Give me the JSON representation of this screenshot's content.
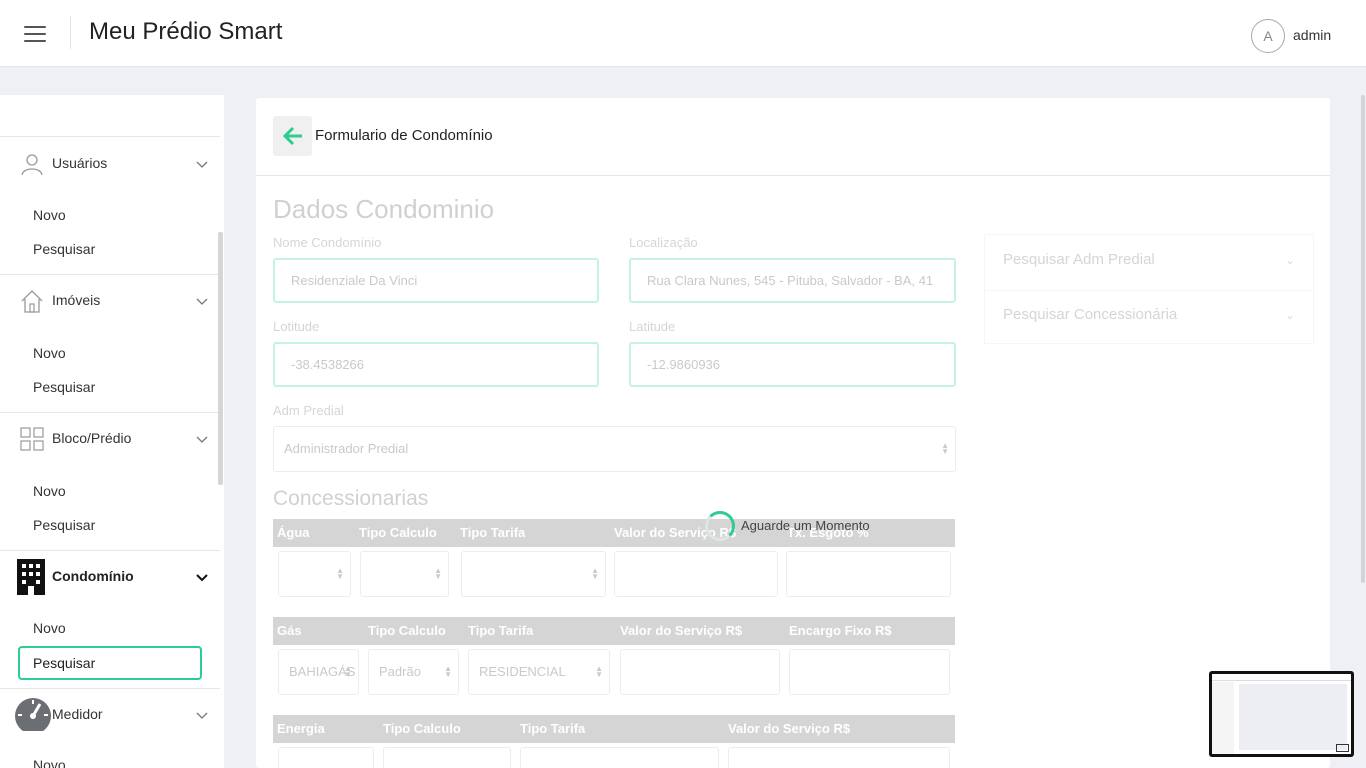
{
  "header": {
    "app_title": "Meu Prédio Smart",
    "avatar_letter": "A",
    "username": "admin"
  },
  "sidebar": {
    "sections": [
      {
        "label": "Usuários",
        "icon": "user-icon",
        "items": [
          "Novo",
          "Pesquisar"
        ]
      },
      {
        "label": "Imóveis",
        "icon": "house-icon",
        "items": [
          "Novo",
          "Pesquisar"
        ]
      },
      {
        "label": "Bloco/Prédio",
        "icon": "grid-icon",
        "items": [
          "Novo",
          "Pesquisar"
        ]
      },
      {
        "label": "Condomínio",
        "icon": "building-icon",
        "items": [
          "Novo",
          "Pesquisar"
        ],
        "active": true,
        "active_item": "Pesquisar"
      },
      {
        "label": "Medidor",
        "icon": "gauge-icon",
        "items": [
          "Novo"
        ]
      }
    ]
  },
  "card": {
    "title": "Formulario de Condomínio"
  },
  "form": {
    "section_title": "Dados Condominio",
    "nome_label": "Nome Condomínio",
    "nome_value": "Residenziale Da Vinci",
    "localizacao_label": "Localização",
    "localizacao_value": "Rua Clara Nunes, 545 - Pituba, Salvador - BA, 41",
    "lotitude_label": "Lotitude",
    "lotitude_value": "-38.4538266",
    "latitude_label": "Latitude",
    "latitude_value": "-12.9860936",
    "adm_label": "Adm Predial",
    "adm_value": "Administrador Predial",
    "concessionarias_title": "Concessionarias",
    "agua_headers": [
      "Água",
      "Tipo Calculo",
      "Tipo Tarifa",
      "Valor do Serviço R$",
      "Tx. Esgoto %"
    ],
    "gas_headers": [
      "Gás",
      "Tipo Calculo",
      "Tipo Tarifa",
      "Valor do Serviço R$",
      "Encargo Fixo R$"
    ],
    "gas_values": {
      "empresa": "BAHIAGÁS",
      "tipo_calculo": "Padrão",
      "tipo_tarifa": "RESIDENCIAL"
    },
    "energia_headers": [
      "Energia",
      "Tipo Calculo",
      "Tipo Tarifa",
      "Valor do Serviço R$"
    ]
  },
  "right_panel": {
    "items": [
      "Pesquisar Adm Predial",
      "Pesquisar Concessionária"
    ]
  },
  "loader": {
    "text": "Aguarde um Momento"
  },
  "colors": {
    "accent": "#2ecc8f",
    "background": "#eef0f6"
  }
}
